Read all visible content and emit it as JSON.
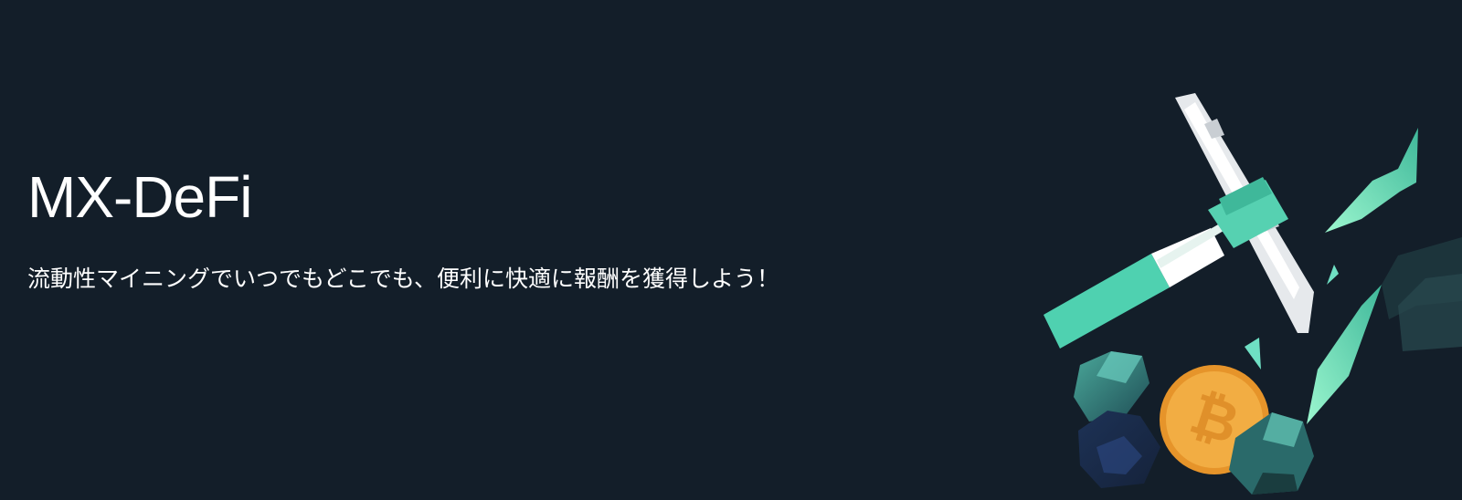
{
  "banner": {
    "title": "MX-DeFi",
    "subtitle": "流動性マイニングでいつでもどこでも、便利に快適に報酬を獲得しよう！"
  },
  "colors": {
    "background": "#131e29",
    "text": "#ffffff",
    "accent_green": "#4fd1b0",
    "coin_orange": "#f0a53a"
  },
  "illustration": {
    "icons": [
      "pickaxe-icon",
      "bitcoin-coin-icon",
      "crystal-icon"
    ]
  }
}
